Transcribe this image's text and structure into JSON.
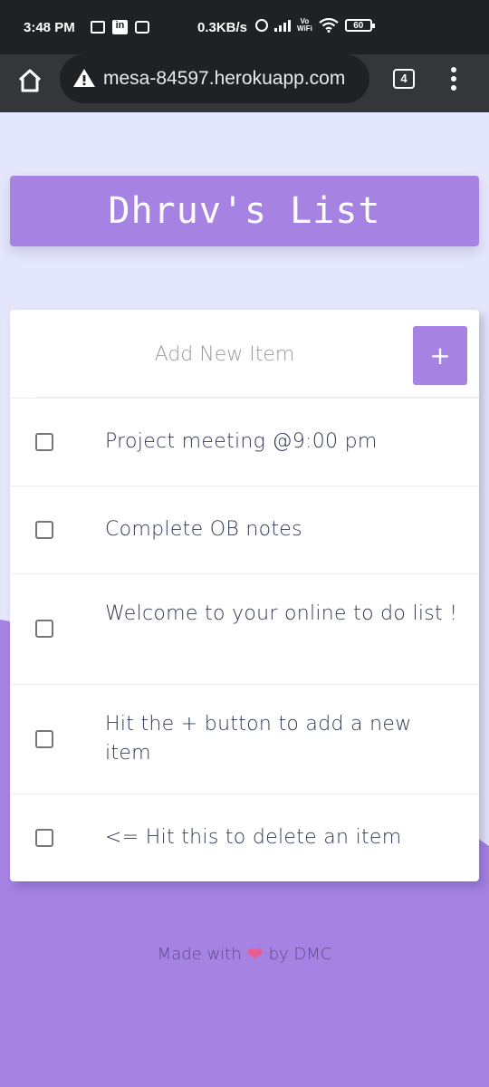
{
  "status_bar": {
    "time": "3:48 PM",
    "speed": "0.3KB/s",
    "vowifi_top": "Vo",
    "vowifi_bottom": "WiFi",
    "battery": "60",
    "icons": [
      "laptop-icon",
      "linkedin-icon",
      "grid-icon",
      "alarm-icon",
      "signal-icon",
      "wifi-icon",
      "battery-icon"
    ]
  },
  "browser": {
    "url": "mesa-84597.herokuapp.com",
    "tab_count": "4",
    "icons": [
      "home-icon",
      "warning-icon",
      "menu-icon"
    ]
  },
  "app": {
    "title": "Dhruv's List",
    "add_placeholder": "Add New Item",
    "add_button": "+",
    "items": [
      {
        "label": "Project meeting @9:00 pm",
        "checked": false
      },
      {
        "label": "Complete OB notes",
        "checked": false
      },
      {
        "label": "Welcome to your online to do list !",
        "checked": false
      },
      {
        "label": "Hit the + button to add a new item",
        "checked": false
      },
      {
        "label": "<= Hit this to delete an item",
        "checked": false
      }
    ],
    "footer_prefix": "Made with",
    "footer_heart": "❤",
    "footer_suffix": "by DMC"
  },
  "colors": {
    "accent": "#A683E3",
    "background": "#E4E6FB",
    "text": "#2F3854",
    "browser_bar": "#35363A",
    "status_bar": "#202124"
  }
}
